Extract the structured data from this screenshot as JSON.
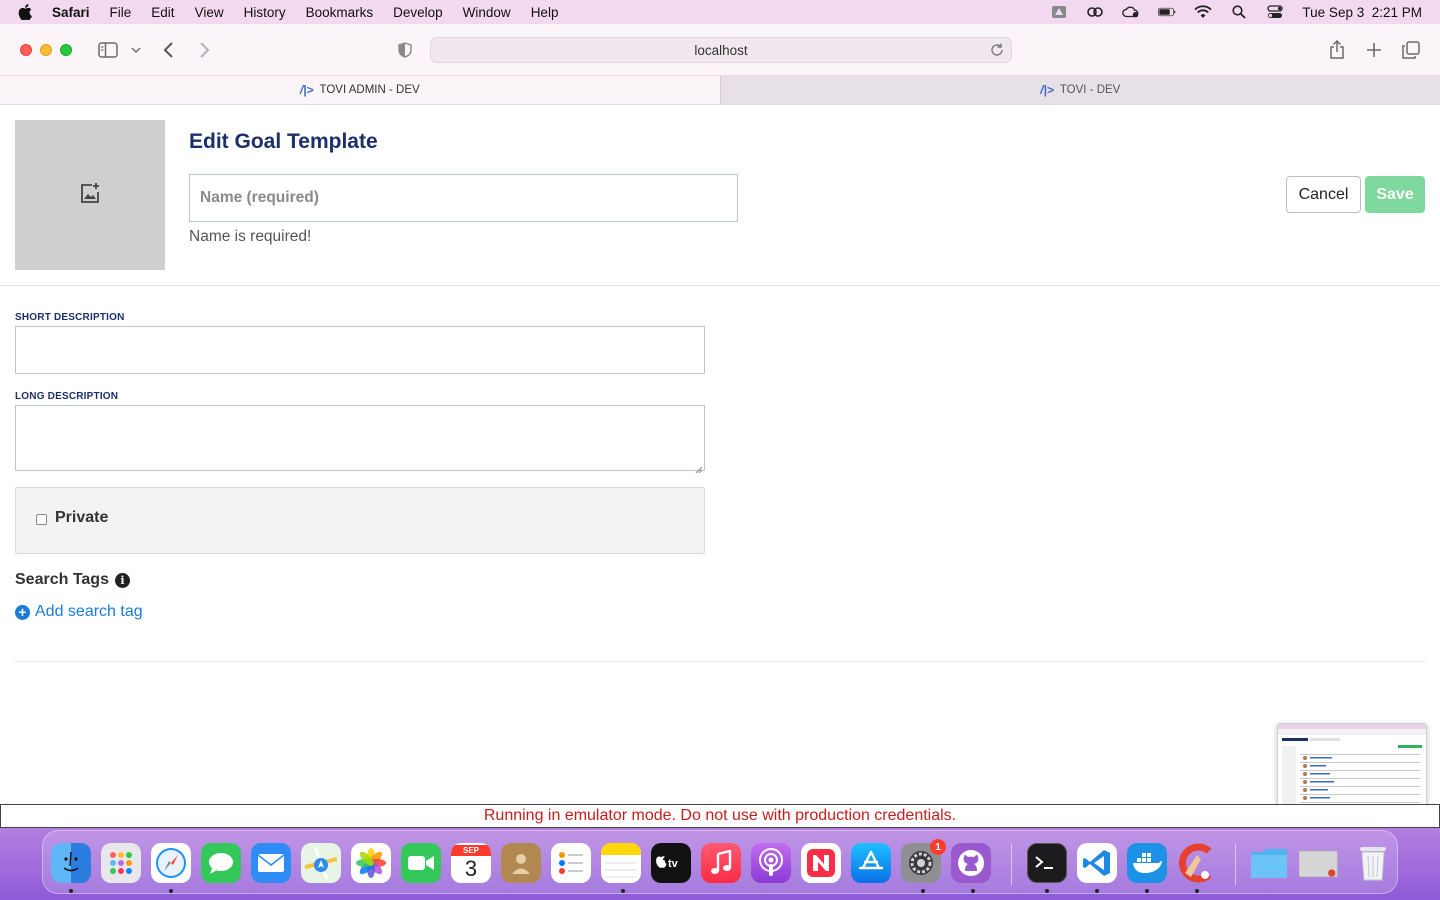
{
  "menubar": {
    "app_name": "Safari",
    "items": [
      "File",
      "Edit",
      "View",
      "History",
      "Bookmarks",
      "Develop",
      "Window",
      "Help"
    ],
    "datetime": "Tue Sep 3  2:21 PM"
  },
  "browser": {
    "url": "localhost",
    "tabs": [
      {
        "label": "TOVI ADMIN - DEV",
        "active": true
      },
      {
        "label": "TOVI - DEV",
        "active": false
      }
    ]
  },
  "form": {
    "title": "Edit Goal Template",
    "name_placeholder": "Name (required)",
    "name_value": "",
    "name_error": "Name is required!",
    "cancel_label": "Cancel",
    "save_label": "Save",
    "short_description_label": "SHORT DESCRIPTION",
    "short_description_value": "",
    "long_description_label": "LONG DESCRIPTION",
    "long_description_value": "",
    "private_label": "Private",
    "private_checked": false,
    "search_tags_label": "Search Tags",
    "add_search_tag_label": "Add search tag"
  },
  "banner": {
    "text": "Running in emulator mode. Do not use with production credentials."
  },
  "dock": {
    "calendar_month": "SEP",
    "calendar_day": "3",
    "settings_badge": "1"
  },
  "colors": {
    "title": "#1c2f6a",
    "save_button": "#7fd89d",
    "link": "#1a7cd8",
    "banner_text": "#c81d1d",
    "menubar_bg": "#f3d9f0"
  }
}
